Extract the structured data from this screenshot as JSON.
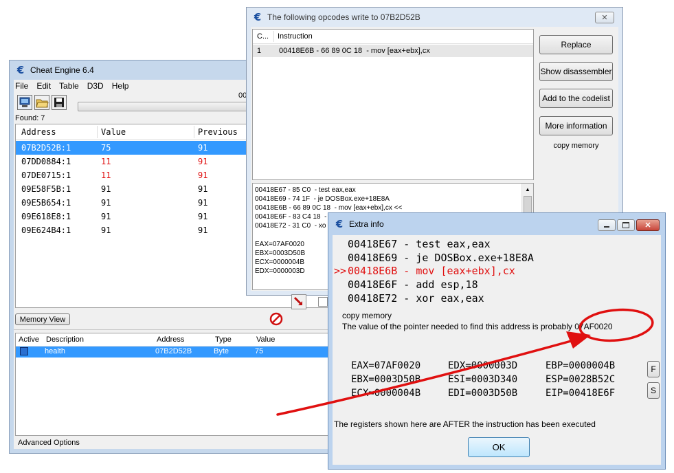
{
  "cheat_engine": {
    "title": "Cheat Engine 6.4",
    "menu": [
      "File",
      "Edit",
      "Table",
      "D3D",
      "Help"
    ],
    "found_label": "Found: 7",
    "progress_partial": "00",
    "headers": [
      "Address",
      "Value",
      "Previous"
    ],
    "results": [
      {
        "address": "07B2D52B:1",
        "value": "75",
        "previous": "91",
        "selected": true,
        "changed": false
      },
      {
        "address": "07DD0884:1",
        "value": "11",
        "previous": "91",
        "selected": false,
        "changed": true
      },
      {
        "address": "07DE0715:1",
        "value": "11",
        "previous": "91",
        "selected": false,
        "changed": true
      },
      {
        "address": "09E58F5B:1",
        "value": "91",
        "previous": "91",
        "selected": false,
        "changed": false
      },
      {
        "address": "09E5B654:1",
        "value": "91",
        "previous": "91",
        "selected": false,
        "changed": false
      },
      {
        "address": "09E618E8:1",
        "value": "91",
        "previous": "91",
        "selected": false,
        "changed": false
      },
      {
        "address": "09E624B4:1",
        "value": "91",
        "previous": "91",
        "selected": false,
        "changed": false
      }
    ],
    "memory_view_button": "Memory View",
    "table_headers": [
      "Active",
      "Description",
      "Address",
      "Type",
      "Value"
    ],
    "table_row": {
      "description": "health",
      "address": "07B2D52B",
      "type": "Byte",
      "value": "75"
    },
    "advanced_options": "Advanced Options"
  },
  "opcodes_window": {
    "title": "The following opcodes write to 07B2D52B",
    "headers": [
      "C...",
      "Instruction"
    ],
    "rows": [
      {
        "count": "1",
        "instruction": "00418E6B - 66 89 0C 18  - mov [eax+ebx],cx"
      }
    ],
    "buttons": {
      "replace": "Replace",
      "show_disassembler": "Show disassembler",
      "add_to_codelist": "Add to the codelist",
      "more_information": "More information"
    },
    "copy_memory": "copy memory",
    "disasm_lines": [
      "00418E67 - 85 C0  - test eax,eax",
      "00418E69 - 74 1F  - je DOSBox.exe+18E8A",
      "00418E6B - 66 89 0C 18  - mov [eax+ebx],cx <<",
      "00418E6F - 83 C4 18  -",
      "00418E72 - 31 C0  - xo"
    ],
    "registers": [
      "EAX=07AF0020",
      "EBX=0003D50B",
      "ECX=0000004B",
      "EDX=0000003D"
    ]
  },
  "extra_info": {
    "title": "Extra info",
    "code_lines": [
      {
        "prefix": "",
        "text": "00418E67 - test eax,eax",
        "highlight": false
      },
      {
        "prefix": "",
        "text": "00418E69 - je DOSBox.exe+18E8A",
        "highlight": false
      },
      {
        "prefix": ">>",
        "text": "00418E6B - mov [eax+ebx],cx",
        "highlight": true
      },
      {
        "prefix": "",
        "text": "00418E6F - add esp,18",
        "highlight": false
      },
      {
        "prefix": "",
        "text": "00418E72 - xor eax,eax",
        "highlight": false
      }
    ],
    "copy_memory": "copy memory",
    "pointer_text": "The value of the pointer needed to find this address is probably 07AF0020",
    "registers": [
      [
        "EAX=07AF0020",
        "EDX=0000003D",
        "EBP=0000004B"
      ],
      [
        "EBX=0003D50B",
        "ESI=0003D340",
        "ESP=0028B52C"
      ],
      [
        "ECX=0000004B",
        "EDI=0003D50B",
        "EIP=00418E6F"
      ]
    ],
    "f_button": "F",
    "s_button": "S",
    "note": "The registers shown here are AFTER the instruction has been executed",
    "ok_button": "OK"
  },
  "colors": {
    "selection": "#3399ff",
    "changed_value": "#e01010",
    "annotation": "#e01010",
    "ce_frame": "#c6d8ec",
    "opcode_frame": "#dfe9f5",
    "extra_frame": "#bcd3ee"
  }
}
